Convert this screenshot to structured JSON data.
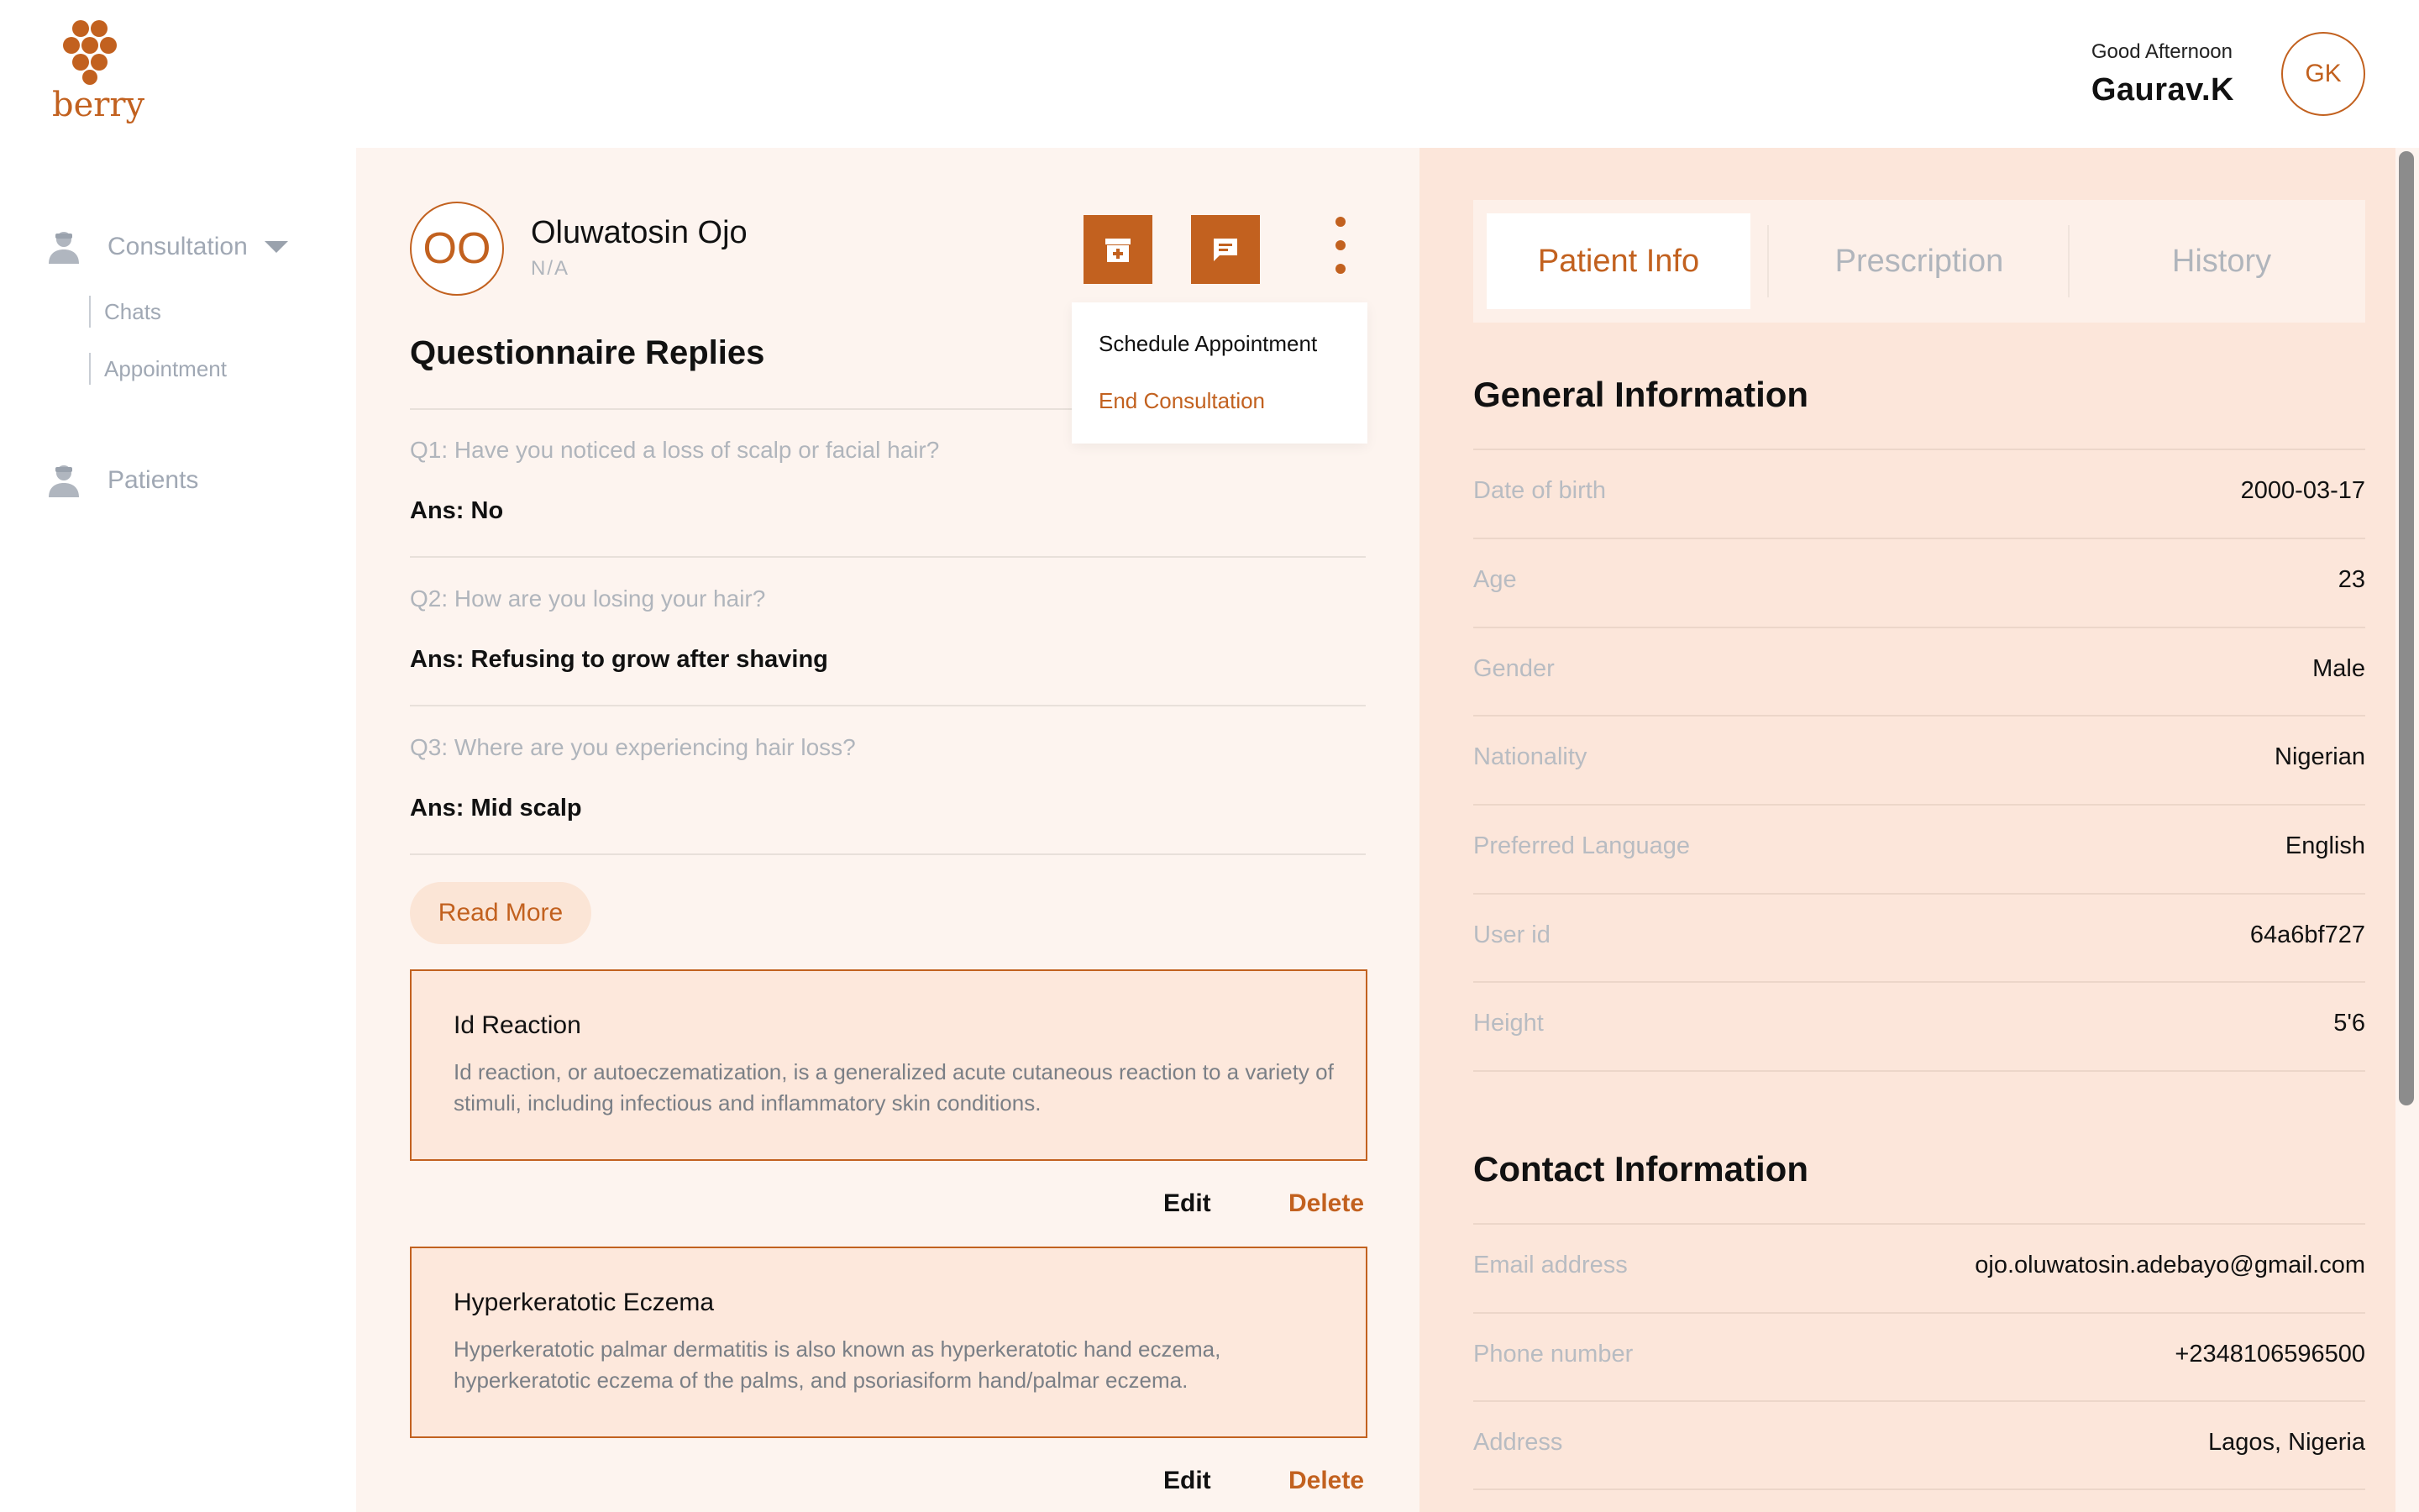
{
  "brand": {
    "name": "berry",
    "accent": "#c2611f"
  },
  "header": {
    "greeting": "Good Afternoon",
    "user_name": "Gaurav.K",
    "user_initials": "GK"
  },
  "sidebar": {
    "consultation": "Consultation",
    "chats": "Chats",
    "appointment": "Appointment",
    "patients": "Patients"
  },
  "patient": {
    "initials": "OO",
    "name": "Oluwatosin Ojo",
    "subtitle": "N/A"
  },
  "actions": {
    "menu": {
      "schedule": "Schedule Appointment",
      "end": "End Consultation"
    }
  },
  "questionnaire": {
    "title": "Questionnaire Replies",
    "items": [
      {
        "q": "Q1: Have you noticed a loss of scalp or facial hair?",
        "a": "Ans: No"
      },
      {
        "q": "Q2: How are you losing your hair?",
        "a": "Ans: Refusing to grow after shaving"
      },
      {
        "q": "Q3: Where are you experiencing hair loss?",
        "a": "Ans: Mid scalp"
      }
    ],
    "read_more": "Read More"
  },
  "diagnoses": [
    {
      "title": "Id Reaction",
      "text": "Id reaction, or autoeczematization, is a generalized acute cutaneous reaction to a variety of stimuli, including infectious and inflammatory skin conditions.",
      "edit": "Edit",
      "delete": "Delete"
    },
    {
      "title": "Hyperkeratotic Eczema",
      "text": "Hyperkeratotic palmar dermatitis is also known as hyperkeratotic hand eczema, hyperkeratotic eczema of the palms, and psoriasiform hand/palmar eczema.",
      "edit": "Edit",
      "delete": "Delete"
    }
  ],
  "tabs": [
    "Patient Info",
    "Prescription",
    "History"
  ],
  "general_info": {
    "title": "General Information",
    "rows": [
      {
        "label": "Date of birth",
        "value": "2000-03-17"
      },
      {
        "label": "Age",
        "value": "23"
      },
      {
        "label": "Gender",
        "value": "Male"
      },
      {
        "label": "Nationality",
        "value": "Nigerian"
      },
      {
        "label": "Preferred Language",
        "value": "English"
      },
      {
        "label": "User id",
        "value": "64a6bf727"
      },
      {
        "label": "Height",
        "value": "5'6"
      }
    ]
  },
  "contact_info": {
    "title": "Contact Information",
    "rows": [
      {
        "label": "Email address",
        "value": "ojo.oluwatosin.adebayo@gmail.com"
      },
      {
        "label": "Phone number",
        "value": "+2348106596500"
      },
      {
        "label": "Address",
        "value": "Lagos, Nigeria"
      }
    ]
  }
}
